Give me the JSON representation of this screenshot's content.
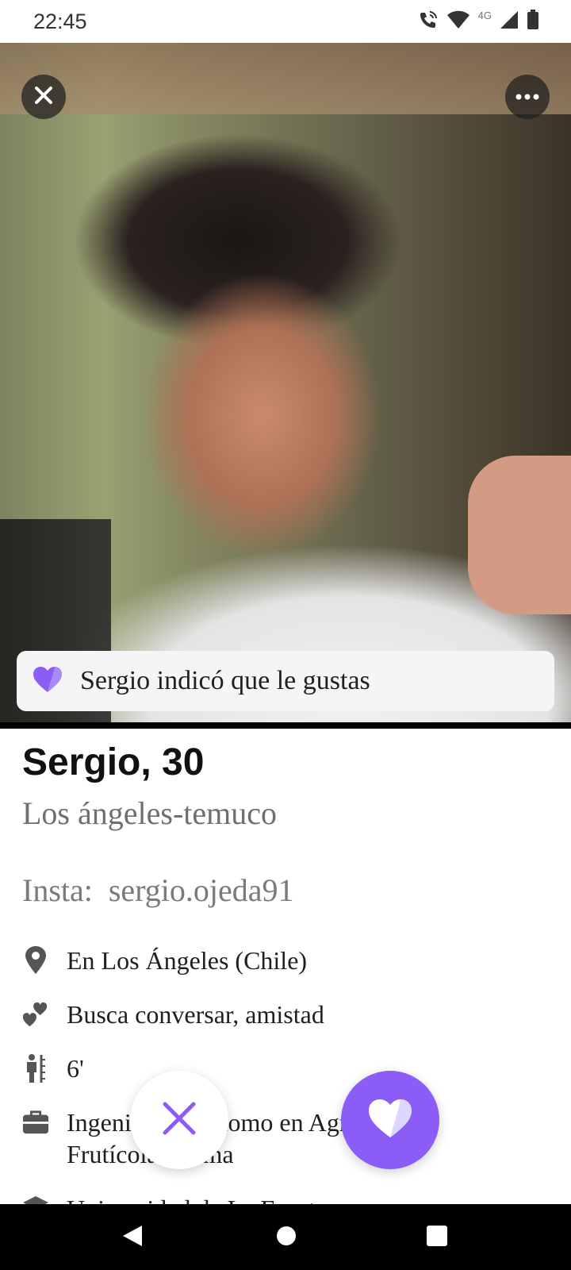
{
  "status_bar": {
    "time": "22:45",
    "network_label": "4G",
    "icons": [
      "wifi-calling-icon",
      "wifi-icon",
      "signal-icon",
      "battery-icon"
    ]
  },
  "photo": {
    "close_icon": "close-icon",
    "more_icon": "more-icon"
  },
  "like_banner": {
    "text": "Sergio indicó que le gustas",
    "icon": "heart-icon"
  },
  "profile": {
    "name_age": "Sergio, 30",
    "location_line": "Los ángeles-temuco",
    "bio": "Insta:  sergio.ojeda91",
    "details": [
      {
        "icon": "location-pin-icon",
        "text": "En Los Ángeles (Chile)"
      },
      {
        "icon": "looking-for-icon",
        "text": "Busca conversar, amistad"
      },
      {
        "icon": "height-icon",
        "text": "6'"
      },
      {
        "icon": "briefcase-icon",
        "text": "Ingeniero agrónomo en Agrícola y Frutícola Karma"
      },
      {
        "icon": "education-icon",
        "text": "Universidad de La Frontera"
      }
    ]
  },
  "actions": {
    "dislike_icon": "close-icon",
    "like_icon": "heart-icon"
  },
  "colors": {
    "accent": "#8b5cf6",
    "accent_light": "#c4b5fd"
  },
  "nav_bar": {
    "icons": [
      "back-icon",
      "home-icon",
      "recents-icon"
    ]
  }
}
